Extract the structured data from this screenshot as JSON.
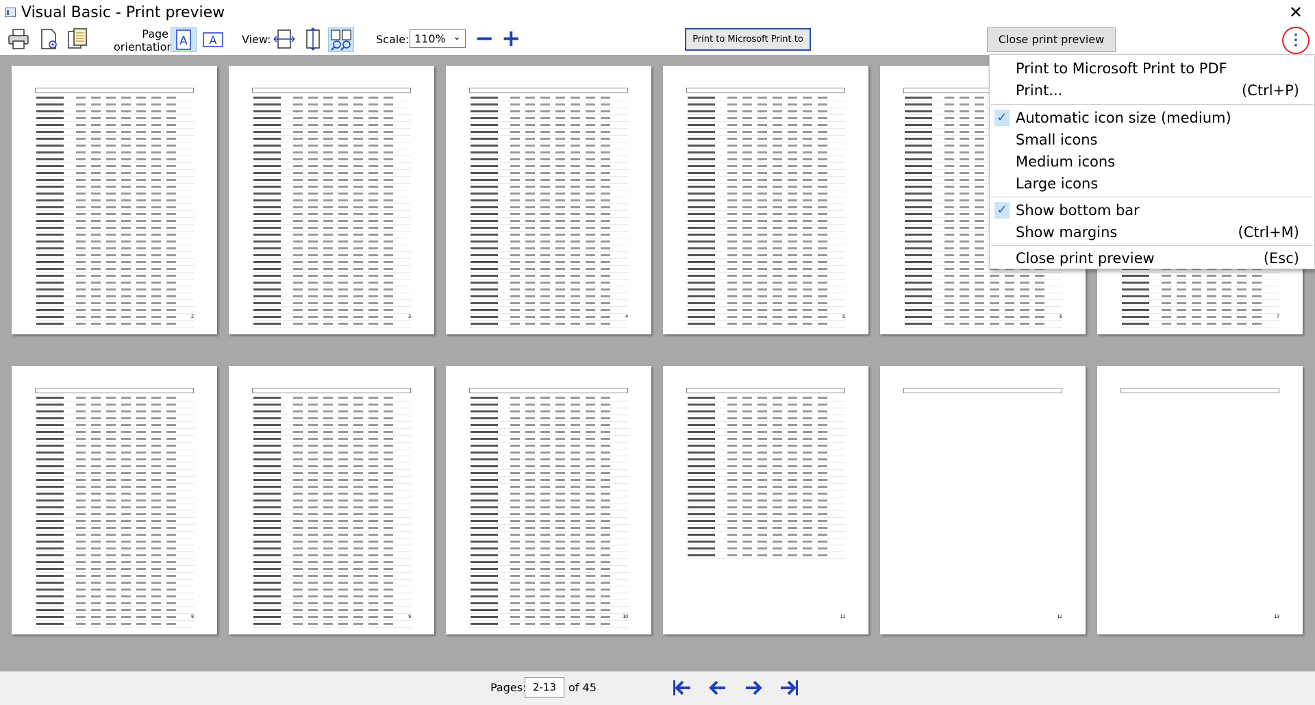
{
  "window": {
    "title": "Visual Basic - Print preview",
    "close_glyph": "✕"
  },
  "toolbar": {
    "page_orientation_label": "Page\norientation:",
    "view_label": "View:",
    "scale_label": "Scale:",
    "scale_value": "110%",
    "zoom_out": "−",
    "zoom_in": "+",
    "print_pdf_button": "Print to Microsoft Print to PDF",
    "close_preview_button": "Close print preview",
    "more_glyph": "⋮"
  },
  "pages": [
    {
      "num": "2"
    },
    {
      "num": "3"
    },
    {
      "num": "4"
    },
    {
      "num": "5"
    },
    {
      "num": "6"
    },
    {
      "num": "7"
    },
    {
      "num": "8"
    },
    {
      "num": "9"
    },
    {
      "num": "10"
    },
    {
      "num": "11"
    },
    {
      "num": "12"
    },
    {
      "num": "13"
    }
  ],
  "menu": {
    "items": [
      {
        "label": "Print to Microsoft Print to PDF",
        "shortcut": "",
        "checked": false
      },
      {
        "label": "Print...",
        "shortcut": "(Ctrl+P)",
        "checked": false
      },
      {
        "label": "Automatic icon size (medium)",
        "shortcut": "",
        "checked": true
      },
      {
        "label": "Small icons",
        "shortcut": "",
        "checked": false
      },
      {
        "label": "Medium icons",
        "shortcut": "",
        "checked": false
      },
      {
        "label": "Large icons",
        "shortcut": "",
        "checked": false
      },
      {
        "label": "Show bottom bar",
        "shortcut": "",
        "checked": true
      },
      {
        "label": "Show margins",
        "shortcut": "(Ctrl+M)",
        "checked": false
      },
      {
        "label": "Close print preview",
        "shortcut": "(Esc)",
        "checked": false
      }
    ],
    "check_glyph": "✓"
  },
  "bottom": {
    "pages_label": "Pages:",
    "pages_value": "2-13",
    "of_label": "of 45"
  },
  "colors": {
    "accent": "#1f3fbf",
    "highlight": "#cce4f7",
    "background": "#a8a8a8"
  }
}
